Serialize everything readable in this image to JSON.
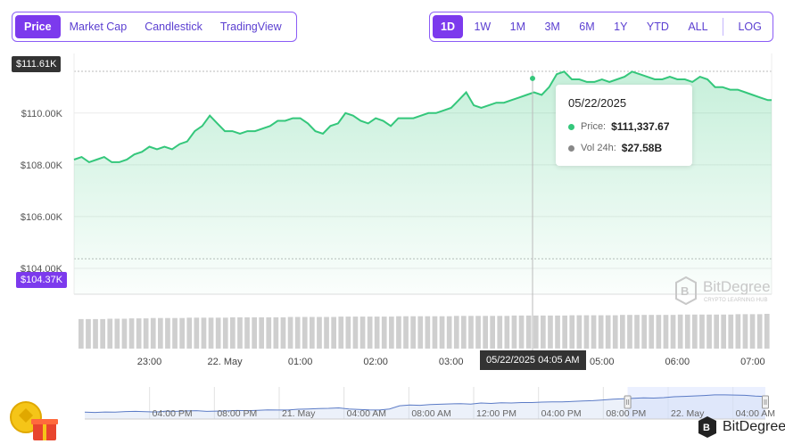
{
  "tabs": [
    "Price",
    "Market Cap",
    "Candlestick",
    "TradingView"
  ],
  "active_tab": 0,
  "ranges": [
    "1D",
    "1W",
    "1M",
    "3M",
    "6M",
    "1Y",
    "YTD",
    "ALL"
  ],
  "active_range": 0,
  "log_label": "LOG",
  "colors": {
    "accent": "#7c3aed",
    "line": "#34c77b",
    "volume": "#c9c9c9",
    "tag": "#333333"
  },
  "price_high_tag": "$111.61K",
  "price_low_tag": "$104.37K",
  "tooltip": {
    "date": "05/22/2025",
    "price_label": "Price:",
    "price_value": "$111,337.67",
    "vol_label": "Vol 24h:",
    "vol_value": "$27.58B"
  },
  "crosshair_time_label": "05/22/2025 04:05 AM",
  "watermark": {
    "name": "BitDegree",
    "tagline": "CRYPTO LEARNING HUB",
    "icon": "bitdegree-logo-icon"
  },
  "brand": {
    "name": "BitDegree",
    "icon": "bitdegree-logo-icon"
  },
  "promo_icon": "gift-coin-icon",
  "chart_data": {
    "type": "area",
    "y_ticks": [
      "$110.00K",
      "$108.00K",
      "$106.00K",
      "$104.00K"
    ],
    "y_tick_values": [
      110000,
      108000,
      106000,
      104000
    ],
    "x_ticks": [
      "23:00",
      "22. May",
      "01:00",
      "02:00",
      "03:00",
      "05:00",
      "06:00",
      "07:00"
    ],
    "x_tick_hours": [
      23,
      24,
      25,
      26,
      27,
      29,
      30,
      31
    ],
    "x_range_hours": [
      22,
      31.25
    ],
    "ylim": [
      103000,
      112300
    ],
    "grid": true,
    "series": [
      {
        "x": [
          22,
          22.1,
          22.2,
          22.3,
          22.4,
          22.5,
          22.6,
          22.7,
          22.8,
          22.9,
          23,
          23.1,
          23.2,
          23.3,
          23.4,
          23.5,
          23.6,
          23.7,
          23.8,
          23.9,
          24,
          24.1,
          24.2,
          24.3,
          24.4,
          24.5,
          24.6,
          24.7,
          24.8,
          24.9,
          25,
          25.1,
          25.2,
          25.3,
          25.4,
          25.5,
          25.6,
          25.7,
          25.8,
          25.9,
          26,
          26.1,
          26.2,
          26.3,
          26.4,
          26.5,
          26.6,
          26.7,
          26.8,
          26.9,
          27,
          27.1,
          27.2,
          27.3,
          27.4,
          27.5,
          27.6,
          27.7,
          27.8,
          27.9,
          28,
          28.1,
          28.2,
          28.3,
          28.4,
          28.5,
          28.6,
          28.7,
          28.8,
          28.9,
          29,
          29.1,
          29.2,
          29.3,
          29.4,
          29.5,
          29.6,
          29.7,
          29.8,
          29.9,
          30,
          30.1,
          30.2,
          30.3,
          30.4,
          30.5,
          30.6,
          30.7,
          30.8,
          30.9,
          31,
          31.1,
          31.2,
          31.25
        ],
        "values": [
          108200,
          108300,
          108100,
          108200,
          108300,
          108100,
          108100,
          108200,
          108400,
          108500,
          108700,
          108600,
          108700,
          108600,
          108800,
          108900,
          109300,
          109500,
          109900,
          109600,
          109300,
          109300,
          109200,
          109300,
          109300,
          109400,
          109500,
          109700,
          109700,
          109800,
          109800,
          109600,
          109300,
          109200,
          109500,
          109600,
          110000,
          109900,
          109700,
          109600,
          109800,
          109700,
          109500,
          109800,
          109800,
          109800,
          109900,
          110000,
          110000,
          110100,
          110200,
          110500,
          110800,
          110300,
          110200,
          110300,
          110400,
          110400,
          110500,
          110600,
          110700,
          110800,
          110700,
          111000,
          111500,
          111600,
          111300,
          111300,
          111200,
          111200,
          111300,
          111200,
          111300,
          111400,
          111600,
          111500,
          111400,
          111300,
          111300,
          111400,
          111300,
          111300,
          111200,
          111400,
          111300,
          111000,
          111000,
          110900,
          110900,
          110800,
          110700,
          110600,
          110500,
          110500
        ]
      }
    ],
    "volume_bars": 96,
    "volume_values": [
      0.85,
      0.85,
      0.85,
      0.85,
      0.86,
      0.86,
      0.86,
      0.87,
      0.87,
      0.87,
      0.88,
      0.88,
      0.88,
      0.88,
      0.88,
      0.89,
      0.89,
      0.89,
      0.89,
      0.89,
      0.89,
      0.9,
      0.9,
      0.9,
      0.9,
      0.9,
      0.9,
      0.9,
      0.9,
      0.91,
      0.91,
      0.91,
      0.91,
      0.91,
      0.91,
      0.91,
      0.92,
      0.92,
      0.92,
      0.92,
      0.92,
      0.92,
      0.92,
      0.92,
      0.93,
      0.93,
      0.93,
      0.93,
      0.93,
      0.93,
      0.93,
      0.93,
      0.94,
      0.94,
      0.94,
      0.94,
      0.94,
      0.94,
      0.94,
      0.94,
      0.95,
      0.95,
      0.95,
      0.95,
      0.95,
      0.95,
      0.95,
      0.95,
      0.96,
      0.96,
      0.96,
      0.96,
      0.96,
      0.96,
      0.96,
      0.97,
      0.97,
      0.97,
      0.97,
      0.97,
      0.97,
      0.97,
      0.97,
      0.98,
      0.98,
      0.98,
      0.98,
      0.98,
      0.98,
      0.98,
      0.98,
      0.99,
      0.99,
      0.99,
      0.99,
      1.0
    ],
    "crosshair_x_hour": 28.08,
    "crosshair_value": 111337.67,
    "navigator": {
      "labels": [
        "04:00 PM",
        "08:00 PM",
        "21. May",
        "04:00 AM",
        "08:00 AM",
        "12:00 PM",
        "04:00 PM",
        "08:00 PM",
        "22. May",
        "04:00 AM"
      ],
      "label_hours": [
        -16,
        -12,
        -8,
        -4,
        0,
        4,
        8,
        12,
        16,
        20
      ],
      "range_hours": [
        -20,
        22
      ],
      "selected_hours": [
        13.5,
        22
      ],
      "ylim": [
        100000,
        115000
      ],
      "values": [
        103200,
        103100,
        103300,
        103200,
        103500,
        103600,
        103400,
        103300,
        103700,
        103600,
        103800,
        103900,
        103600,
        103700,
        103800,
        104000,
        103900,
        104100,
        104300,
        104200,
        104200,
        104600,
        104700,
        104900,
        105000,
        105200,
        104700,
        104500,
        104300,
        104200,
        104700,
        106200,
        106600,
        106400,
        106800,
        106900,
        107100,
        107200,
        107000,
        107500,
        107300,
        107600,
        107500,
        107700,
        107700,
        107900,
        108000,
        108000,
        108200,
        108400,
        108600,
        108900,
        109300,
        109500,
        109700,
        109900,
        109800,
        110000,
        110400,
        110600,
        110800,
        111000,
        111300,
        111300,
        111200,
        111100,
        110700,
        110500
      ]
    }
  }
}
